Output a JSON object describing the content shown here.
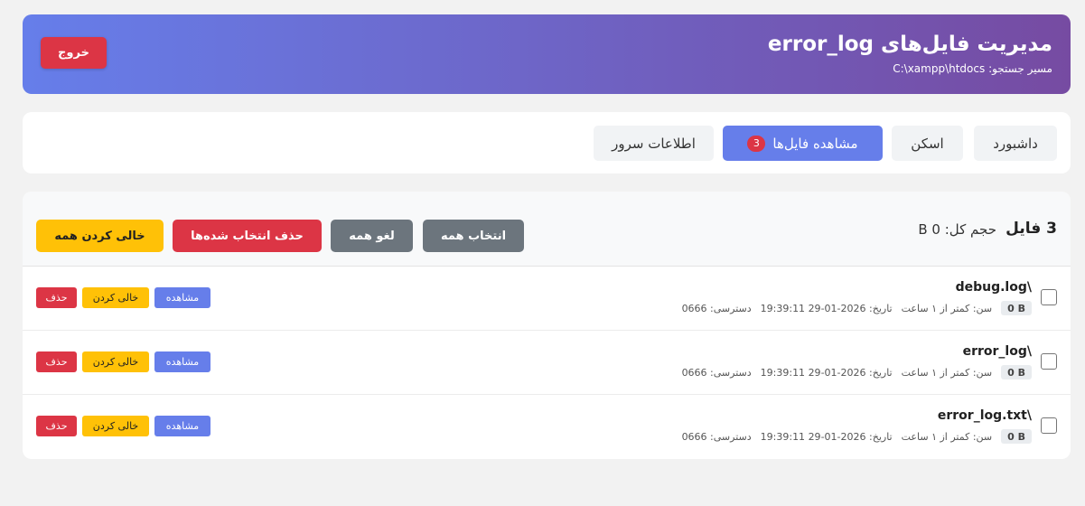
{
  "header": {
    "title": "مدیریت فایل‌های error_log",
    "search_path_label": "مسیر جستجو: C:\\xampp\\htdocs",
    "logout_label": "خروج",
    "colors": {
      "gradient_start": "#667eea",
      "gradient_end": "#764ba2",
      "logout": "#dc3545"
    }
  },
  "tabs": [
    {
      "label": "داشبورد",
      "active": false
    },
    {
      "label": "اسکن",
      "active": false
    },
    {
      "label": "مشاهده فایل‌ها",
      "active": true,
      "badge": "3"
    },
    {
      "label": "اطلاعات سرور",
      "active": false
    }
  ],
  "files_panel": {
    "count_label": "3 فایل",
    "total_size_label": "حجم کل: 0 B",
    "buttons": {
      "select_all": "انتخاب همه",
      "deselect_all": "لغو همه",
      "delete_selected": "حذف انتخاب شده‌ها",
      "clear_all": "خالی کردن همه"
    },
    "files": [
      {
        "name": "\\debug.log",
        "size": "0 B",
        "age": "سن: کمتر از ۱ ساعت",
        "date": "تاریخ: 2026-01-29 19:39:11",
        "permissions": "دسترسی: 0666",
        "checked": false
      },
      {
        "name": "\\error_log",
        "size": "0 B",
        "age": "سن: کمتر از ۱ ساعت",
        "date": "تاریخ: 2026-01-29 19:39:11",
        "permissions": "دسترسی: 0666",
        "checked": false
      },
      {
        "name": "\\error_log.txt",
        "size": "0 B",
        "age": "سن: کمتر از ۱ ساعت",
        "date": "تاریخ: 2026-01-29 19:39:11",
        "permissions": "دسترسی: 0666",
        "checked": false
      }
    ],
    "row_actions": {
      "view": "مشاهده",
      "clear": "خالی کردن",
      "delete": "حذف"
    }
  }
}
